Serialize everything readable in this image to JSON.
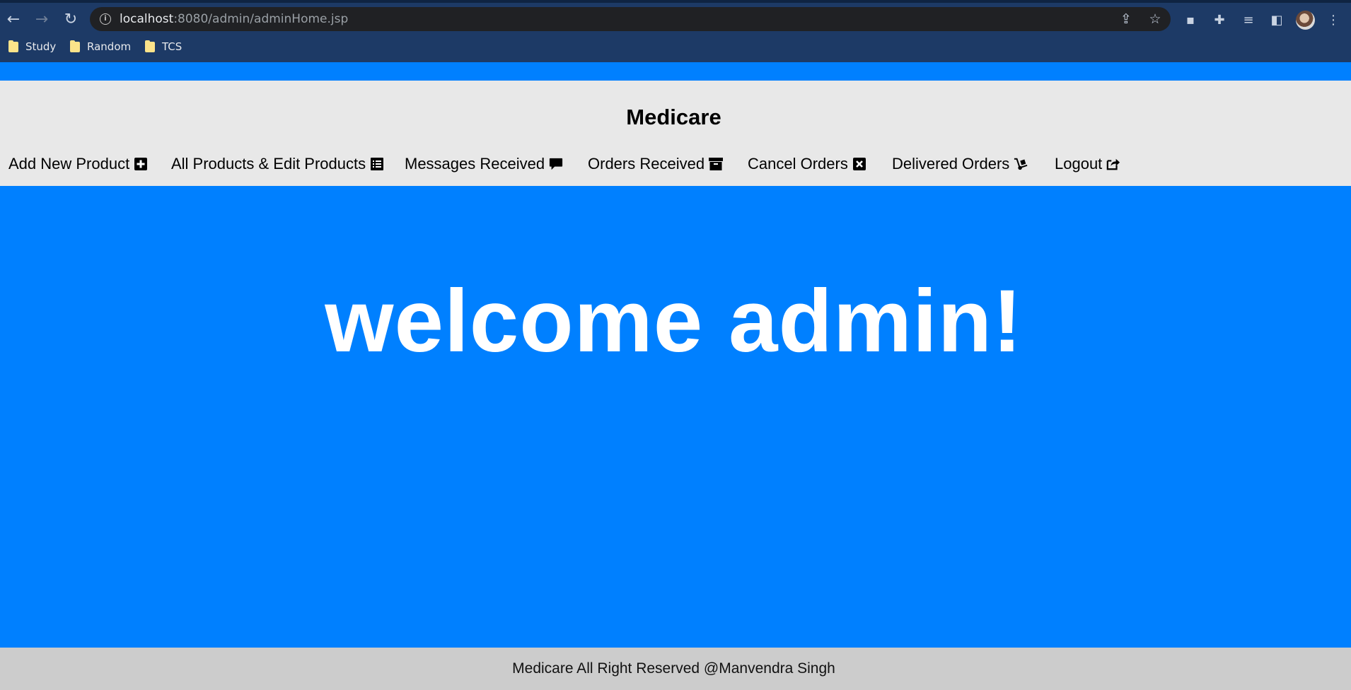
{
  "browser": {
    "url_host": "localhost",
    "url_path": ":8080/admin/adminHome.jsp",
    "bookmarks": [
      {
        "label": "Study"
      },
      {
        "label": "Random"
      },
      {
        "label": "TCS"
      }
    ]
  },
  "site": {
    "brand": "Medicare",
    "nav": [
      {
        "label": "Add New Product",
        "icon": "plus-square-icon"
      },
      {
        "label": "All Products & Edit Products",
        "icon": "list-alt-icon"
      },
      {
        "label": "Messages Received",
        "icon": "comment-icon"
      },
      {
        "label": "Orders Received",
        "icon": "archive-icon"
      },
      {
        "label": "Cancel Orders",
        "icon": "x-square-icon"
      },
      {
        "label": "Delivered Orders",
        "icon": "dolly-icon"
      },
      {
        "label": "Logout",
        "icon": "share-square-icon"
      }
    ],
    "welcome": "welcome admin!",
    "footer": "Medicare All Right Reserved @Manvendra Singh"
  },
  "colors": {
    "page_background": "#0080ff",
    "header_background": "#e8e8e8",
    "footer_background": "#cccccc",
    "browser_chrome": "#1d3a66"
  }
}
